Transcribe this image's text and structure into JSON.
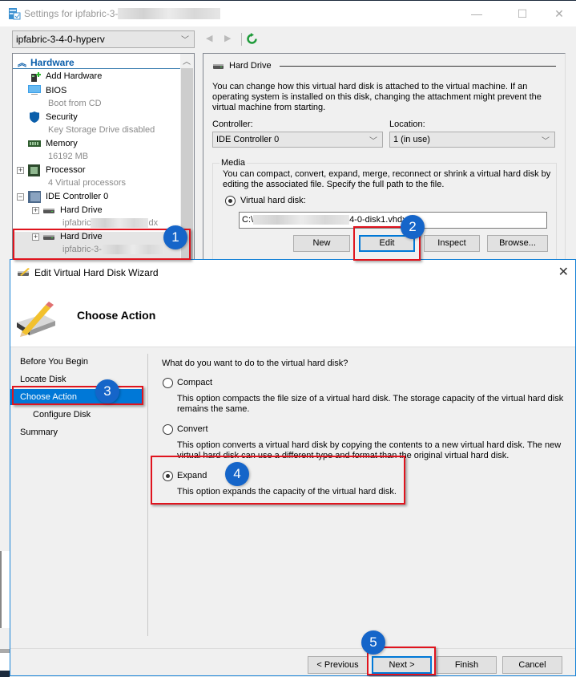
{
  "settings_window": {
    "title_prefix": "Settings for ipfabric-3-",
    "title_redacted": "4-0-hyperv-xxxxxxxxxxx",
    "controls": {
      "minimize": "—",
      "maximize": "☐",
      "close": "✕"
    },
    "vm_selector": {
      "value": "ipfabric-3-4-0-hyperv"
    },
    "nav": {
      "back": "◀",
      "forward": "▶",
      "refresh": "↻"
    },
    "tree": {
      "section": "Hardware",
      "items": [
        {
          "label": "Add Hardware",
          "sub": ""
        },
        {
          "label": "BIOS",
          "sub": "Boot from CD"
        },
        {
          "label": "Security",
          "sub": "Key Storage Drive disabled"
        },
        {
          "label": "Memory",
          "sub": "16192 MB"
        },
        {
          "label": "Processor",
          "sub": "4 Virtual processors"
        },
        {
          "label": "IDE Controller 0",
          "sub": ""
        },
        {
          "label": "Hard Drive",
          "sub_prefix": "ipfabric",
          "sub_suffix": "dx"
        },
        {
          "label": "Hard Drive",
          "sub_prefix": "ipfabric-3-",
          "sub_suffix": ""
        }
      ]
    },
    "details": {
      "section_title": "Hard Drive",
      "description": "You can change how this virtual hard disk is attached to the virtual machine. If an operating system is installed on this disk, changing the attachment might prevent the virtual machine from starting.",
      "controller_label": "Controller:",
      "controller_value": "IDE Controller 0",
      "location_label": "Location:",
      "location_value": "1 (in use)",
      "media": {
        "label": "Media",
        "description": "You can compact, convert, expand, merge, reconnect or shrink a virtual hard disk by editing the associated file. Specify the full path to the file.",
        "vhd_radio_label": "Virtual hard disk:",
        "path_prefix": "C:\\",
        "path_suffix": "4-0-disk1.vhdx",
        "buttons": {
          "new": "New",
          "edit": "Edit",
          "inspect": "Inspect",
          "browse": "Browse..."
        }
      }
    }
  },
  "wizard": {
    "title": "Edit Virtual Hard Disk Wizard",
    "close": "✕",
    "header": "Choose Action",
    "steps": [
      {
        "label": "Before You Begin",
        "active": false,
        "indent": false
      },
      {
        "label": "Locate Disk",
        "active": false,
        "indent": false
      },
      {
        "label": "Choose Action",
        "active": true,
        "indent": false
      },
      {
        "label": "Configure Disk",
        "active": false,
        "indent": true
      },
      {
        "label": "Summary",
        "active": false,
        "indent": false
      }
    ],
    "question": "What do you want to do to the virtual hard disk?",
    "options": [
      {
        "label": "Compact",
        "selected": false,
        "description": "This option compacts the file size of a virtual hard disk. The storage capacity of the virtual hard disk remains the same."
      },
      {
        "label": "Convert",
        "selected": false,
        "description": "This option converts a virtual hard disk by copying the contents to a new virtual hard disk. The new virtual hard disk can use a different type and format than the original virtual hard disk."
      },
      {
        "label": "Expand",
        "selected": true,
        "description": "This option expands the capacity of the virtual hard disk."
      }
    ],
    "buttons": {
      "previous": "< Previous",
      "next": "Next >",
      "finish": "Finish",
      "cancel": "Cancel"
    }
  },
  "annotations": {
    "highlight_color": "#e0141e",
    "badge_color": "#1565c9",
    "badges": [
      "1",
      "2",
      "3",
      "4",
      "5"
    ]
  }
}
